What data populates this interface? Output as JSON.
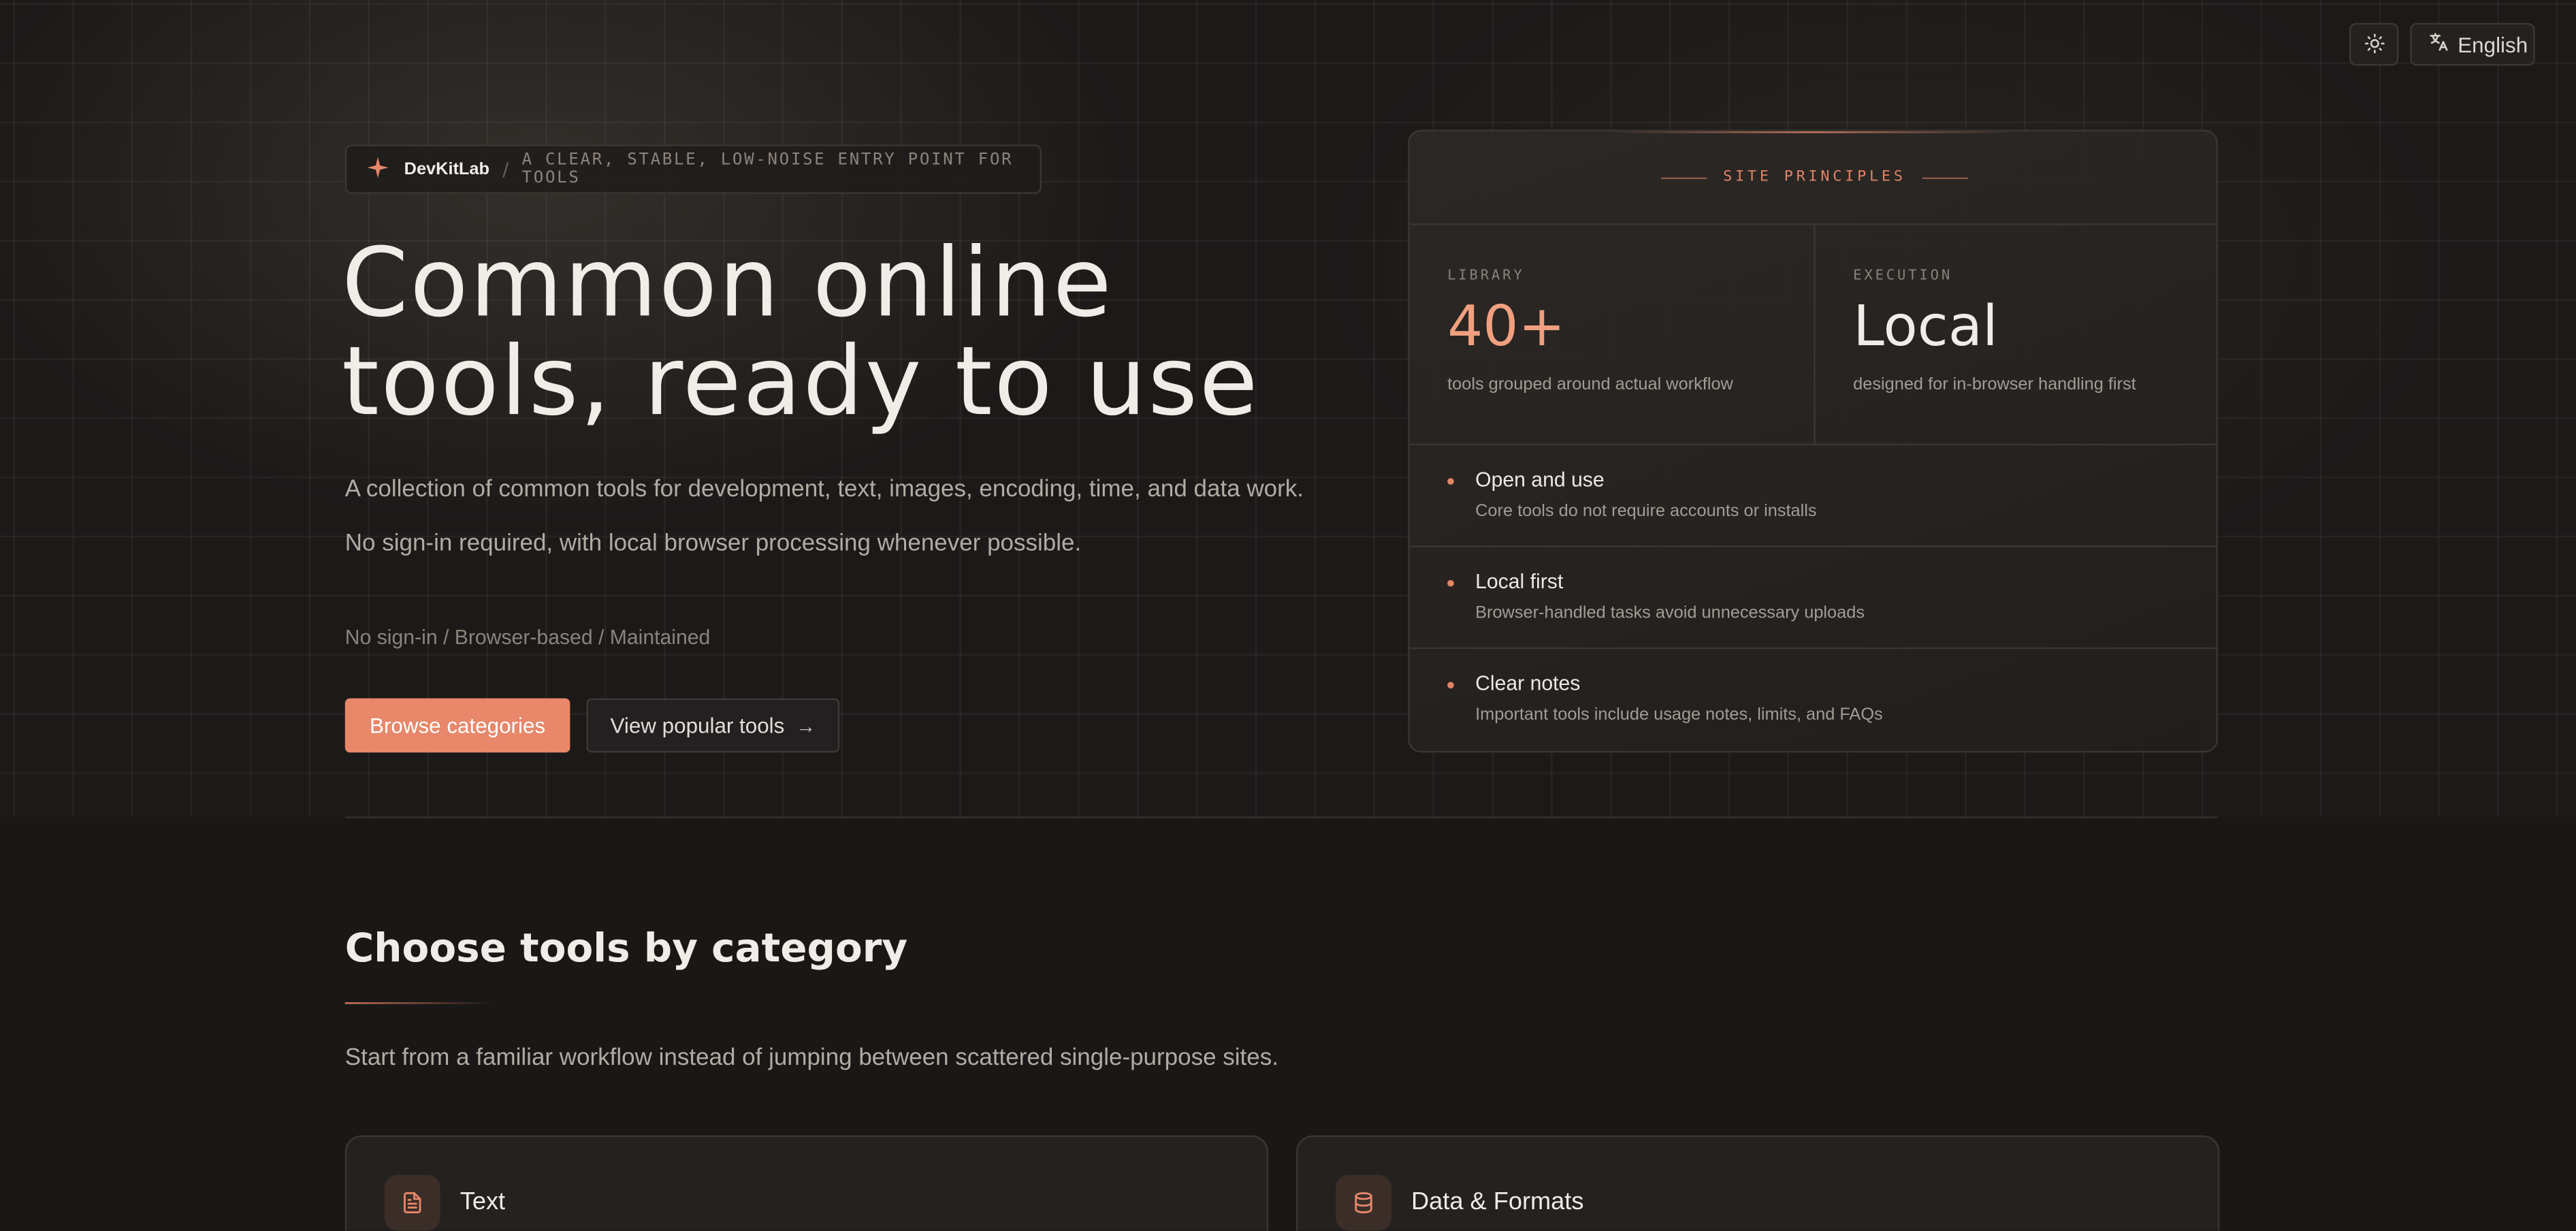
{
  "header": {
    "theme_toggle_icon": "sun-icon",
    "language_label": "English"
  },
  "hero": {
    "brand_name": "DevKitLab",
    "brand_separator": "/",
    "brand_tagline": "A CLEAR, STABLE, LOW-NOISE ENTRY POINT FOR TOOLS",
    "title_line1": "Common online",
    "title_line2": "tools, ready to use",
    "description_line1": "A collection of common tools for development, text, images, encoding, time, and data work.",
    "description_line2": "No sign-in required, with local browser processing whenever possible.",
    "meta": "No sign-in / Browser-based / Maintained",
    "primary_button": "Browse categories",
    "secondary_button": "View popular tools",
    "secondary_button_arrow": "→"
  },
  "principles": {
    "header": "SITE PRINCIPLES",
    "stats": [
      {
        "label": "LIBRARY",
        "value": "40+",
        "description": "tools grouped around actual workflow"
      },
      {
        "label": "EXECUTION",
        "value": "Local",
        "description": "designed for in-browser handling first"
      }
    ],
    "items": [
      {
        "title": "Open and use",
        "description": "Core tools do not require accounts or installs"
      },
      {
        "title": "Local first",
        "description": "Browser-handled tasks avoid unnecessary uploads"
      },
      {
        "title": "Clear notes",
        "description": "Important tools include usage notes, limits, and FAQs"
      }
    ]
  },
  "categories": {
    "title": "Choose tools by category",
    "description": "Start from a familiar workflow instead of jumping between scattered single-purpose sites.",
    "cards": [
      {
        "title": "Text",
        "icon": "document-icon"
      },
      {
        "title": "Data & Formats",
        "icon": "database-icon"
      }
    ]
  },
  "colors": {
    "accent": "#e8876a",
    "accent_text": "#f0a07f",
    "background": "#1a1817"
  }
}
